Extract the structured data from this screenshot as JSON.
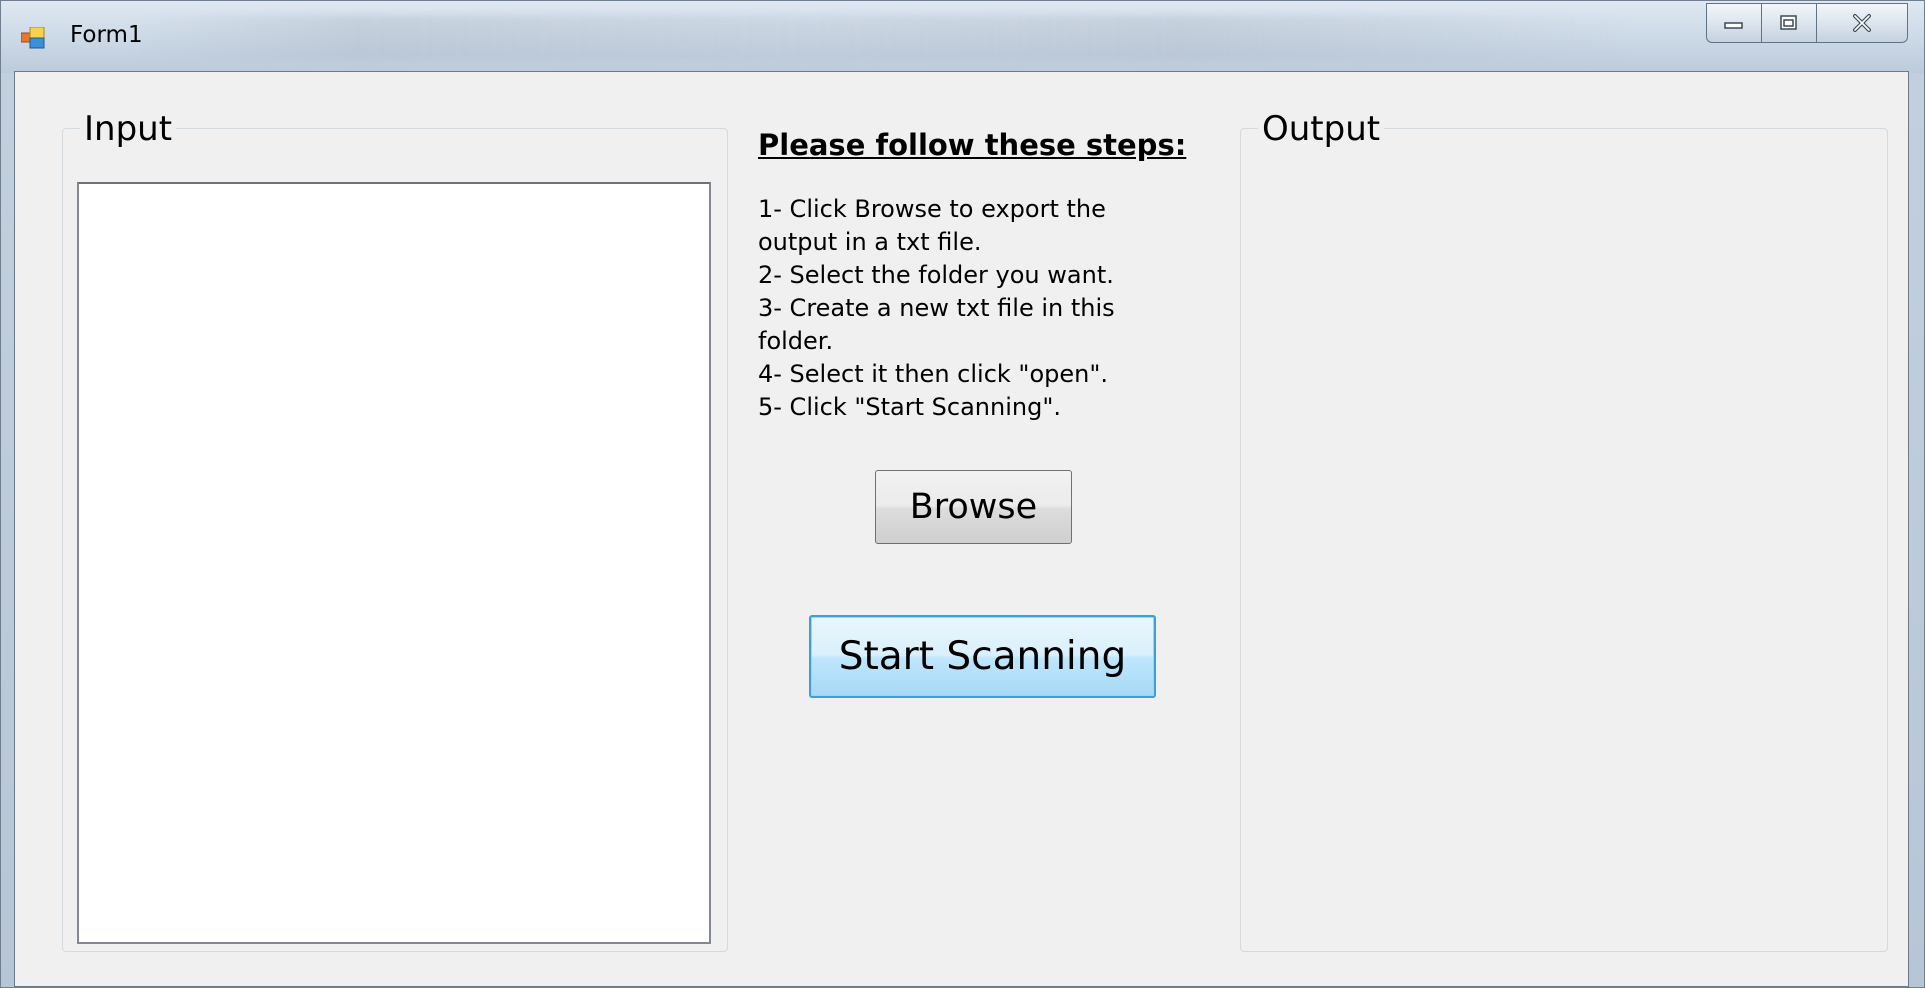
{
  "window": {
    "title": "Form1"
  },
  "input_group": {
    "label": "Input",
    "textbox_value": ""
  },
  "instructions": {
    "heading": "Please follow these steps:",
    "body": "1- Click Browse to export the output in a txt file.\n2- Select the folder you want.\n3- Create a new txt file in this folder.\n4- Select it then click \"open\".\n5- Click \"Start Scanning\"."
  },
  "buttons": {
    "browse_label": "Browse",
    "start_label": "Start Scanning"
  },
  "output_group": {
    "label": "Output"
  },
  "icons": {
    "app": "form-app-icon",
    "minimize": "minimize-icon",
    "maximize": "maximize-icon",
    "close": "close-icon"
  },
  "colors": {
    "client_background": "#f0f0f0",
    "focused_button_border": "#3c9fd8"
  }
}
